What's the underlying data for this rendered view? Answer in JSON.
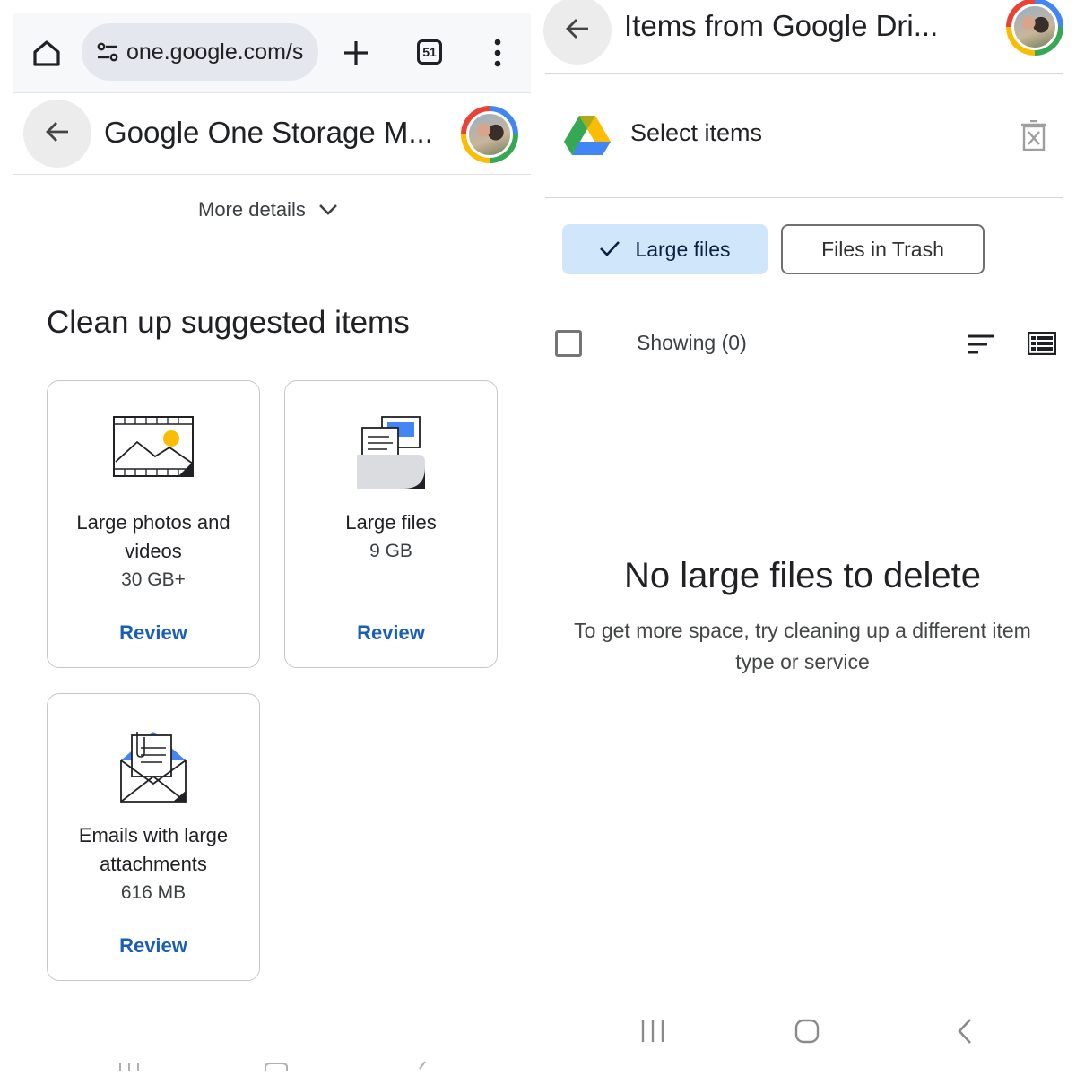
{
  "left": {
    "browser": {
      "url": "one.google.com/s",
      "tab_count": "51"
    },
    "header": {
      "title": "Google One Storage M..."
    },
    "more_details": "More details",
    "section_title": "Clean up suggested items",
    "cards": [
      {
        "title": "Large photos and videos",
        "size": "30 GB+",
        "action": "Review",
        "icon": "photo-film-icon"
      },
      {
        "title": "Large files",
        "size": "9 GB",
        "action": "Review",
        "icon": "documents-folder-icon"
      },
      {
        "title": "Emails with large attachments",
        "size": "616 MB",
        "action": "Review",
        "icon": "envelope-attachment-icon"
      }
    ]
  },
  "right": {
    "header": {
      "title": "Items from Google Dri..."
    },
    "select_items": "Select items",
    "filters": {
      "active": "Large files",
      "inactive": "Files in Trash"
    },
    "showing": "Showing (0)",
    "empty": {
      "title": "No large files to delete",
      "subtitle": "To get more space, try cleaning up a different item type or service"
    }
  },
  "colors": {
    "accent_blue": "#1a5fb4",
    "chip_selected_bg": "#cfe6fb",
    "drive_green": "#34a853",
    "drive_yellow": "#fbbc04",
    "drive_blue": "#4285f4"
  }
}
